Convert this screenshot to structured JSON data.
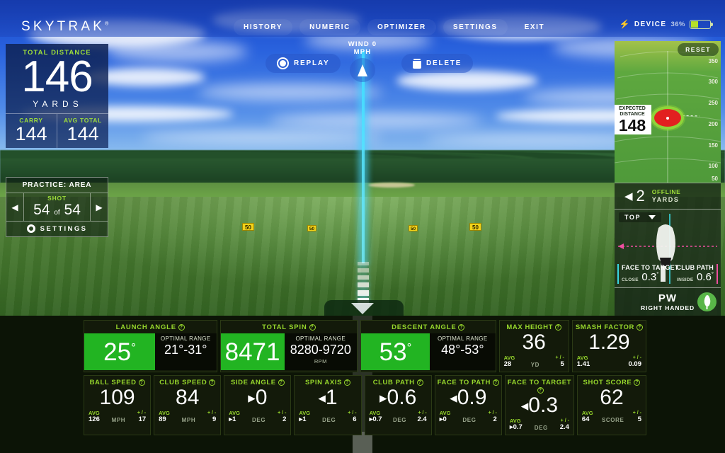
{
  "app": {
    "logo": "SKYTRAK",
    "logo_mark": "®"
  },
  "topnav": {
    "items": [
      {
        "label": "HISTORY"
      },
      {
        "label": "NUMERIC"
      },
      {
        "label": "OPTIMIZER"
      },
      {
        "label": "SETTINGS"
      },
      {
        "label": "EXIT"
      }
    ],
    "device_label": "DEVICE",
    "device_battery": "36%",
    "bolt_icon": "⚡"
  },
  "scene_controls": {
    "replay_label": "REPLAY",
    "delete_label": "DELETE",
    "wind_label": "WIND 0 MPH"
  },
  "course": {
    "yard_markers": [
      "50",
      "50",
      "50",
      "50"
    ]
  },
  "total_distance": {
    "label": "TOTAL DISTANCE",
    "value": "146",
    "unit": "YARDS",
    "carry_label": "CARRY",
    "carry_value": "144",
    "avg_total_label": "AVG TOTAL",
    "avg_total_value": "144"
  },
  "practice": {
    "title": "PRACTICE: AREA",
    "shot_label": "SHOT",
    "shot_current": "54",
    "shot_of": "of",
    "shot_total": "54",
    "settings_label": "SETTINGS",
    "prev_arrow": "◀",
    "next_arrow": "▶"
  },
  "green_view": {
    "reset_label": "RESET",
    "ticks": [
      "350",
      "300",
      "250",
      "200",
      "150",
      "100",
      "50"
    ],
    "expected_label_line1": "EXPECTED",
    "expected_label_line2": "DISTANCE",
    "expected_value": "148",
    "offline_arrow": "◀",
    "offline_value": "2",
    "offline_label": "OFFLINE",
    "offline_unit": "YARDS"
  },
  "club_view": {
    "view_mode": "TOP",
    "face_to_target_label": "FACE TO TARGET",
    "face_to_target_sub": "CLOSE",
    "face_to_target_value": "0.3",
    "face_to_target_deg": "°",
    "club_path_label": "CLUB PATH",
    "club_path_sub": "INSIDE",
    "club_path_value": "0.6",
    "club_path_deg": "°",
    "club_name": "PW",
    "handedness": "RIGHT HANDED"
  },
  "stats_big": [
    {
      "label": "LAUNCH ANGLE",
      "value": "25",
      "deg": "°",
      "optimal_label": "OPTIMAL RANGE",
      "optimal_value": "21°-31°",
      "optimal_unit": ""
    },
    {
      "label": "TOTAL SPIN",
      "value": "8471",
      "deg": "",
      "optimal_label": "OPTIMAL RANGE",
      "optimal_value": "8280-9720",
      "optimal_unit": "RPM"
    },
    {
      "label": "DESCENT ANGLE",
      "value": "53",
      "deg": "°",
      "optimal_label": "OPTIMAL RANGE",
      "optimal_value": "48°-53°",
      "optimal_unit": ""
    }
  ],
  "stats_small_row1": [
    {
      "label": "MAX HEIGHT",
      "arrow": "",
      "value": "36",
      "avg_label": "AVG",
      "avg_arrow": "",
      "avg_value": "28",
      "unit": "YD",
      "pm_label": "+ / -",
      "pm_value": "5"
    },
    {
      "label": "SMASH FACTOR",
      "arrow": "",
      "value": "1.29",
      "avg_label": "AVG",
      "avg_arrow": "",
      "avg_value": "1.41",
      "unit": "",
      "pm_label": "+ / -",
      "pm_value": "0.09"
    }
  ],
  "stats_small_row2": [
    {
      "label": "BALL SPEED",
      "arrow": "",
      "value": "109",
      "avg_label": "AVG",
      "avg_arrow": "",
      "avg_value": "126",
      "unit": "MPH",
      "pm_label": "+ / -",
      "pm_value": "17"
    },
    {
      "label": "CLUB SPEED",
      "arrow": "",
      "value": "84",
      "avg_label": "AVG",
      "avg_arrow": "",
      "avg_value": "89",
      "unit": "MPH",
      "pm_label": "+ / -",
      "pm_value": "9"
    },
    {
      "label": "SIDE ANGLE",
      "arrow": "▸",
      "value": "0",
      "avg_label": "AVG",
      "avg_arrow": "▸",
      "avg_value": "1",
      "unit": "DEG",
      "pm_label": "+ / -",
      "pm_value": "2"
    },
    {
      "label": "SPIN AXIS",
      "arrow": "◂",
      "value": "1",
      "avg_label": "AVG",
      "avg_arrow": "▸",
      "avg_value": "1",
      "unit": "DEG",
      "pm_label": "+ / -",
      "pm_value": "6"
    },
    {
      "label": "CLUB PATH",
      "arrow": "▸",
      "value": "0.6",
      "avg_label": "AVG",
      "avg_arrow": "▸",
      "avg_value": "0.7",
      "unit": "DEG",
      "pm_label": "+ / -",
      "pm_value": "2.4"
    },
    {
      "label": "FACE TO PATH",
      "arrow": "◂",
      "value": "0.9",
      "avg_label": "AVG",
      "avg_arrow": "▸",
      "avg_value": "0",
      "unit": "DEG",
      "pm_label": "+ / -",
      "pm_value": "2"
    },
    {
      "label": "FACE TO TARGET",
      "arrow": "◂",
      "value": "0.3",
      "avg_label": "AVG",
      "avg_arrow": "▸",
      "avg_value": "0.7",
      "unit": "DEG",
      "pm_label": "+ / -",
      "pm_value": "2.4"
    },
    {
      "label": "SHOT SCORE",
      "arrow": "",
      "value": "62",
      "avg_label": "AVG",
      "avg_arrow": "",
      "avg_value": "64",
      "unit": "SCORE",
      "pm_label": "+ / -",
      "pm_value": "5"
    }
  ],
  "colors": {
    "accent_green": "#96d62c",
    "value_green": "#22b422",
    "brand_blue": "#1746c8",
    "battery_green": "#b6e026"
  }
}
